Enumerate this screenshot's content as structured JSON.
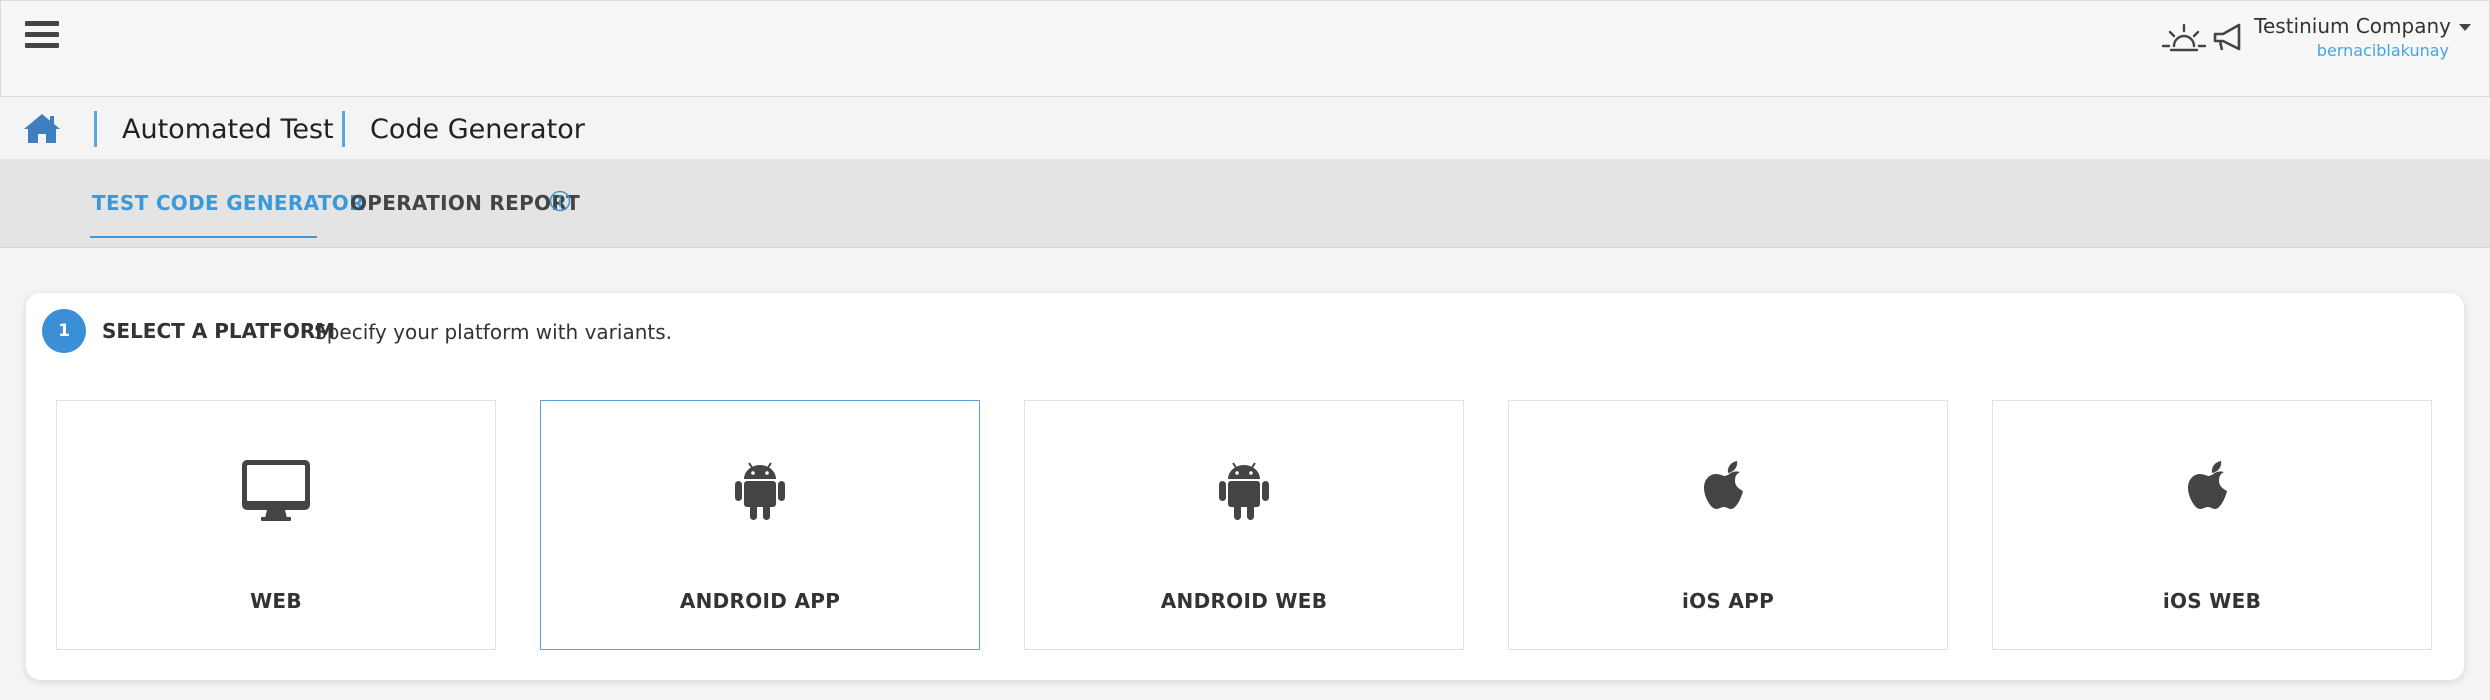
{
  "header": {
    "company_name": "Testinium Company",
    "user_name": "bernaciblakunay"
  },
  "breadcrumb": {
    "items": [
      "Automated Test",
      "Code Generator"
    ]
  },
  "tabs": [
    {
      "label": "TEST CODE GENERATOR",
      "active": true
    },
    {
      "label": "OPERATION REPORT",
      "active": false
    }
  ],
  "step": {
    "number": "1",
    "title": "SELECT A PLATFORM",
    "description": "Specify your platform with variants."
  },
  "platforms": [
    {
      "label": "WEB",
      "icon": "desktop-icon",
      "selected": false
    },
    {
      "label": "ANDROID APP",
      "icon": "android-icon",
      "selected": true
    },
    {
      "label": "ANDROID WEB",
      "icon": "android-icon",
      "selected": false
    },
    {
      "label": "iOS APP",
      "icon": "apple-icon",
      "selected": false
    },
    {
      "label": "iOS WEB",
      "icon": "apple-icon",
      "selected": false
    }
  ],
  "colors": {
    "accent": "#3a9ad9",
    "badge": "#3b8fd6",
    "icon": "#444444"
  }
}
